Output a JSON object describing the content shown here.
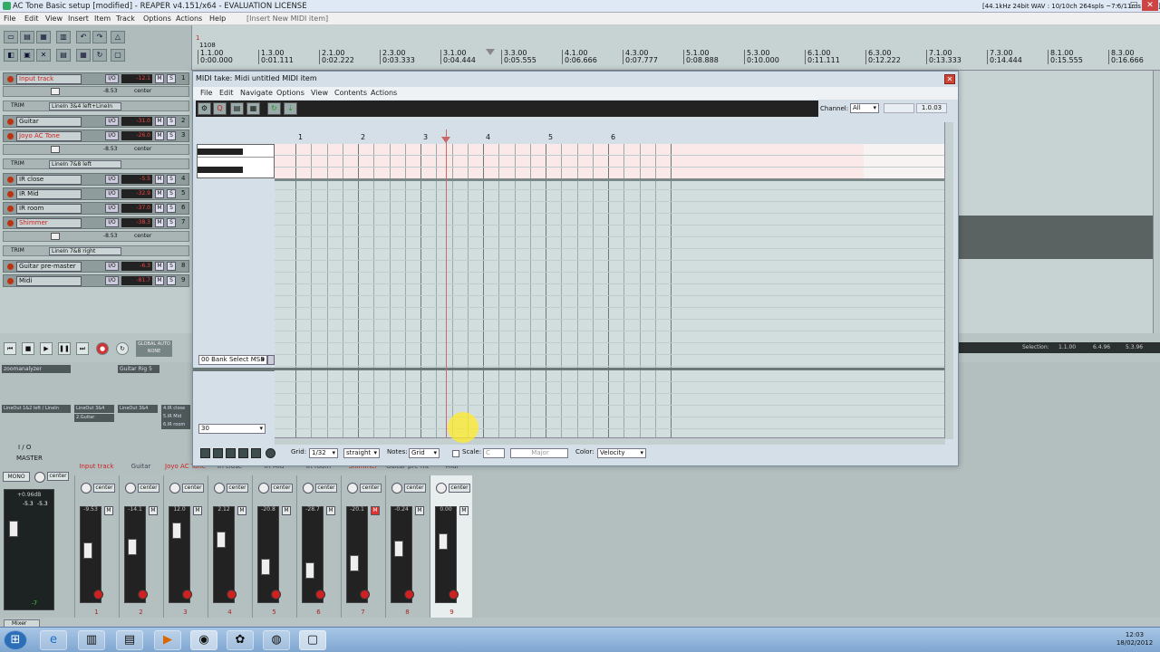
{
  "window": {
    "title": "AC Tone Basic setup [modified] - REAPER v4.151/x64 - EVALUATION LICENSE",
    "status": "[44.1kHz 24bit WAV : 10/10ch 264spls ~7.6/11ms ASIO]"
  },
  "menu": {
    "items": [
      "File",
      "Edit",
      "View",
      "Insert",
      "Item",
      "Track",
      "Options",
      "Actions",
      "Help"
    ],
    "hint": "[Insert New MIDI item]"
  },
  "ruler": {
    "start": "1108",
    "marks": [
      {
        "bar": "1.1.00",
        "time": "0:00.000"
      },
      {
        "bar": "1.3.00",
        "time": "0:01.111"
      },
      {
        "bar": "2.1.00",
        "time": "0:02.222"
      },
      {
        "bar": "2.3.00",
        "time": "0:03.333"
      },
      {
        "bar": "3.1.00",
        "time": "0:04.444"
      },
      {
        "bar": "3.3.00",
        "time": "0:05.555"
      },
      {
        "bar": "4.1.00",
        "time": "0:06.666"
      },
      {
        "bar": "4.3.00",
        "time": "0:07.777"
      },
      {
        "bar": "5.1.00",
        "time": "0:08.888"
      },
      {
        "bar": "5.3.00",
        "time": "0:10.000"
      },
      {
        "bar": "6.1.00",
        "time": "0:11.111"
      },
      {
        "bar": "6.3.00",
        "time": "0:12.222"
      },
      {
        "bar": "7.1.00",
        "time": "0:13.333"
      },
      {
        "bar": "7.3.00",
        "time": "0:14.444"
      },
      {
        "bar": "8.1.00",
        "time": "0:15.555"
      },
      {
        "bar": "8.3.00",
        "time": "0:16.666"
      }
    ]
  },
  "tracks": [
    {
      "name": "Input track",
      "vol": "-12.1",
      "num": "1",
      "sub": "LineIn 3&4 left+LineIn"
    },
    {
      "name": "Guitar",
      "vol": "-31.0",
      "num": "2",
      "sub": ""
    },
    {
      "name": "Joyo AC Tone",
      "vol": "-26.0",
      "num": "3",
      "sub": "LineIn 7&8 left"
    },
    {
      "name": "IR close",
      "vol": "-5.5",
      "num": "4",
      "sub": ""
    },
    {
      "name": "IR Mid",
      "vol": "-32.9",
      "num": "5",
      "sub": ""
    },
    {
      "name": "IR room",
      "vol": "-37.0",
      "num": "6",
      "sub": ""
    },
    {
      "name": "Shimmer",
      "vol": "-38.3",
      "num": "7",
      "sub": "LineIn 7&8 right"
    },
    {
      "name": "Guitar pre-master",
      "vol": "-6.3",
      "num": "8",
      "sub": ""
    },
    {
      "name": "Midi",
      "vol": "-81.7",
      "num": "9",
      "sub": ""
    }
  ],
  "track_labels": {
    "io": "I/O",
    "m": "M",
    "s": "S",
    "trim": "TRIM",
    "center": "center",
    "vol2": "-8.53"
  },
  "transport": {
    "global_auto": "GLOBAL AUTO",
    "global_auto2": "NONE"
  },
  "selection": {
    "label": "Selection:",
    "start": "1.1.00",
    "end": "6.4.96",
    "length": "5.3.96"
  },
  "midi_editor": {
    "title": "MIDI take: Midi untitled MIDI item",
    "menu": [
      "File",
      "Edit",
      "Navigate",
      "Options",
      "View",
      "Contents",
      "Actions"
    ],
    "channel_label": "Channel:",
    "channel_value": "All",
    "position": "1.0.03",
    "bars": [
      "1",
      "2",
      "3",
      "4",
      "5",
      "6"
    ],
    "cc_lane": "00 Bank Select MSB",
    "cc_lane2": "30",
    "grid_label": "Grid:",
    "grid_value": "1/32",
    "grid_type": "straight",
    "notes_label": "Notes:",
    "notes_value": "Grid",
    "scale_label": "Scale:",
    "scale_root": "C",
    "scale_type": "Major",
    "color_label": "Color:",
    "color_value": "Velocity"
  },
  "mixer": {
    "master_label": "MASTER",
    "mono": "MONO",
    "master_io": "I / O",
    "master_vals": [
      "+0.96dB",
      "-5.3",
      "-5.3",
      "-inf",
      "-7"
    ],
    "tab": "Mixer",
    "fx_slots": [
      "zoomanalyzer",
      "Guitar Rig 5"
    ],
    "routing": [
      "LineOut 1&2 left / LineIn",
      "LineOut 3&4",
      "LineOut 3&4",
      "4.IR close",
      "5.IR Mid",
      "6.IR room",
      "2.Guitar"
    ],
    "strips": [
      {
        "name": "Input track",
        "db": "-9.53",
        "num": "1",
        "red": true
      },
      {
        "name": "Guitar",
        "db": "-14.1",
        "num": "2",
        "red": false
      },
      {
        "name": "Joyo AC Tone",
        "db": "12.0",
        "num": "3",
        "red": true
      },
      {
        "name": "IR close",
        "db": "2.12",
        "num": "4",
        "red": false
      },
      {
        "name": "IR Mid",
        "db": "-20.8",
        "num": "5",
        "red": false
      },
      {
        "name": "IR room",
        "db": "-28.7",
        "num": "6",
        "red": false
      },
      {
        "name": "Shimmer",
        "db": "-20.1",
        "num": "7",
        "red": true
      },
      {
        "name": "Guitar pre-mast",
        "db": "-0.24",
        "num": "8",
        "red": false
      },
      {
        "name": "Midi",
        "db": "0.00",
        "num": "9",
        "red": false
      }
    ]
  },
  "clock": {
    "time": "12:03",
    "date": "18/02/2012"
  }
}
